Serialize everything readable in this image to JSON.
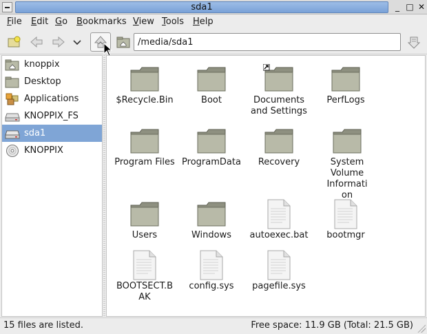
{
  "window": {
    "title": "sda1"
  },
  "menu": [
    {
      "pre": "",
      "u": "F",
      "post": "ile"
    },
    {
      "pre": "",
      "u": "E",
      "post": "dit"
    },
    {
      "pre": "",
      "u": "G",
      "post": "o"
    },
    {
      "pre": "",
      "u": "B",
      "post": "ookmarks"
    },
    {
      "pre": "",
      "u": "V",
      "post": "iew"
    },
    {
      "pre": "",
      "u": "T",
      "post": "ools"
    },
    {
      "pre": "",
      "u": "H",
      "post": "elp"
    }
  ],
  "location": {
    "path": "/media/sda1"
  },
  "sidebar": {
    "items": [
      {
        "label": "knoppix",
        "icon": "home-folder-icon"
      },
      {
        "label": "Desktop",
        "icon": "desktop-folder-icon"
      },
      {
        "label": "Applications",
        "icon": "applications-icon"
      },
      {
        "label": "KNOPPIX_FS",
        "icon": "drive-icon"
      },
      {
        "label": "sda1",
        "icon": "drive-icon",
        "selected": true
      },
      {
        "label": "KNOPPIX",
        "icon": "cdrom-icon"
      }
    ]
  },
  "files": {
    "row1": [
      {
        "name": "$Recycle.Bin",
        "type": "folder"
      },
      {
        "name": "Boot",
        "type": "folder"
      },
      {
        "name": "Documents and Settings",
        "type": "folder-link"
      },
      {
        "name": "PerfLogs",
        "type": "folder"
      }
    ],
    "row2": [
      {
        "name": "Program Files",
        "type": "folder"
      },
      {
        "name": "ProgramData",
        "type": "folder"
      },
      {
        "name": "Recovery",
        "type": "folder"
      },
      {
        "name": "System Volume Information",
        "type": "folder"
      }
    ],
    "row3": [
      {
        "name": "Users",
        "type": "folder"
      },
      {
        "name": "Windows",
        "type": "folder"
      },
      {
        "name": "autoexec.bat",
        "type": "file"
      },
      {
        "name": "bootmgr",
        "type": "file"
      }
    ],
    "row4": [
      {
        "name": "BOOTSECT.BAK",
        "type": "file"
      },
      {
        "name": "config.sys",
        "type": "file"
      },
      {
        "name": "pagefile.sys",
        "type": "file"
      }
    ]
  },
  "status": {
    "count": "15 files are listed.",
    "space": "Free space: 11.9 GB (Total: 21.5 GB)"
  },
  "colors": {
    "selection": "#7fa5d6",
    "titlebar": "#8fb2e1"
  }
}
